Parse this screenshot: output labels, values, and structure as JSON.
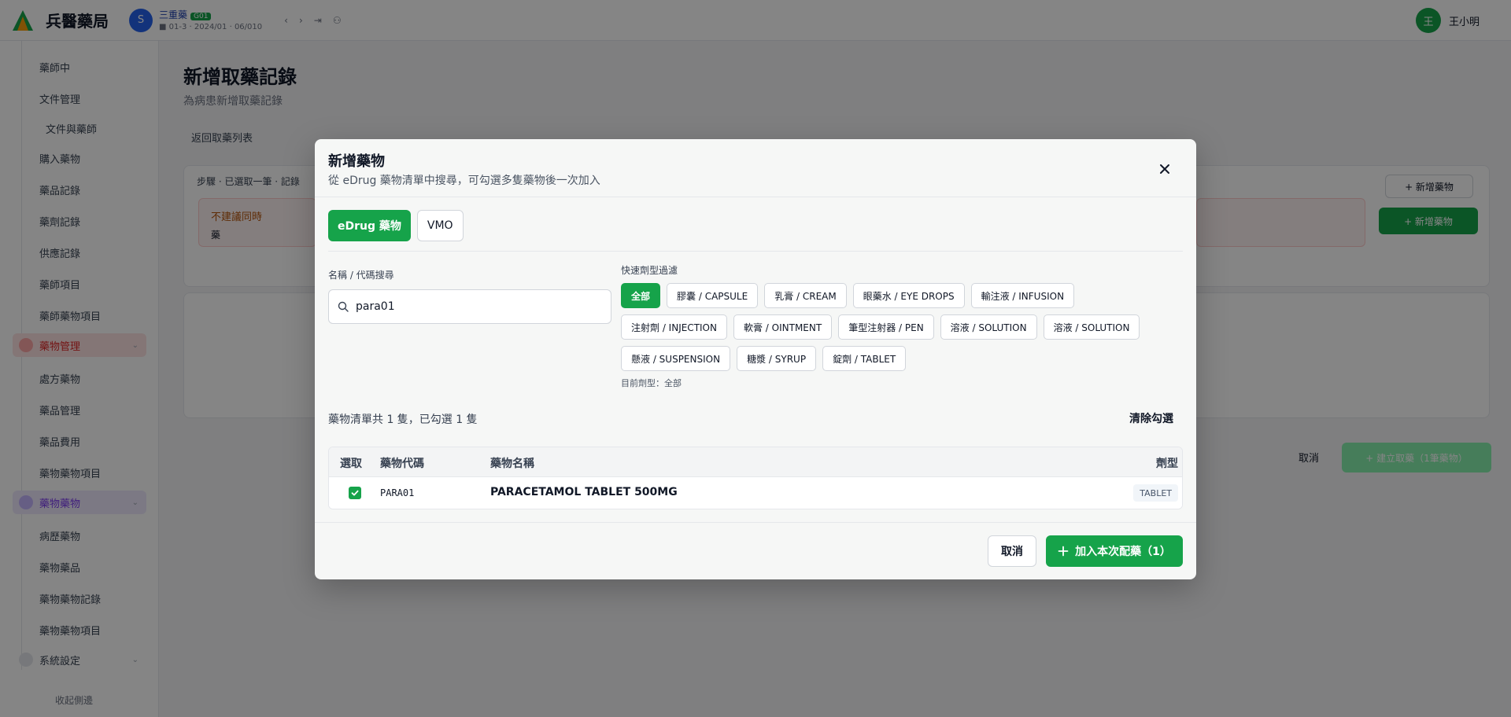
{
  "app": {
    "brand": "兵醫藥局",
    "pharmacy_badge": "S",
    "pharmacy_name": "三重藥",
    "pharmacy_tag": "G01",
    "pharmacy_sub": "■ 01-3 · 2024/01 · 06/010",
    "user_avatar": "王",
    "user_name": "王小明"
  },
  "sidebar": {
    "items": [
      "藥師中",
      "文件管理",
      "文件與藥師",
      "購入藥物",
      "藥品記錄",
      "藥劑記錄",
      "供應記錄",
      "藥師項目",
      "藥師藥物項目",
      "藥物管理",
      "處方藥物",
      "藥品管理",
      "藥品費用",
      "藥物藥物項目",
      "藥物藥物",
      "病歷藥物",
      "藥物藥品",
      "藥物藥物記錄",
      "藥物藥物項目",
      "系統設定"
    ],
    "footer": "收起側邊"
  },
  "page": {
    "title": "新增取藥記錄",
    "subtitle": "為病患新增取藥記錄",
    "back": "返回取藥列表",
    "step_text": "步驟 · 已選取一筆 · 記錄",
    "warn_title": "不建議同時",
    "warn_body": "藥",
    "outline_btn": "+ 新增藥物",
    "green_btn": "+ 新增藥物",
    "cancel": "取消",
    "submit": "+ 建立取藥（1筆藥物）"
  },
  "modal": {
    "title": "新增藥物",
    "subtitle": "從 eDrug 藥物清單中搜尋，可勾選多隻藥物後一次加入",
    "tabs": [
      {
        "label": "eDrug 藥物",
        "active": true
      },
      {
        "label": "VMO",
        "active": false
      }
    ],
    "search": {
      "label": "名稱 / 代碼搜尋",
      "value": "para01"
    },
    "filter": {
      "label": "快速劑型過濾",
      "chips": [
        {
          "label": "全部",
          "active": true
        },
        {
          "label": "膠囊 / CAPSULE",
          "active": false
        },
        {
          "label": "乳膏 / CREAM",
          "active": false
        },
        {
          "label": "眼藥水 / EYE DROPS",
          "active": false
        },
        {
          "label": "輸注液 / INFUSION",
          "active": false
        },
        {
          "label": "注射劑 / INJECTION",
          "active": false
        },
        {
          "label": "軟膏 / OINTMENT",
          "active": false
        },
        {
          "label": "筆型注射器 / PEN",
          "active": false
        },
        {
          "label": "溶液 / SOLUTION",
          "active": false
        },
        {
          "label": "溶液 / SOLUTION",
          "active": false
        },
        {
          "label": "懸液 / SUSPENSION",
          "active": false
        },
        {
          "label": "糖漿 / SYRUP",
          "active": false
        },
        {
          "label": "錠劑 / TABLET",
          "active": false
        }
      ],
      "current": "目前劑型：全部"
    },
    "summary": "藥物清單共 1 隻，已勾選 1 隻",
    "clear": "清除勾選",
    "table": {
      "headers": {
        "select": "選取",
        "code": "藥物代碼",
        "name": "藥物名稱",
        "form": "劑型"
      },
      "rows": [
        {
          "selected": true,
          "code": "PARA01",
          "name": "PARACETAMOL TABLET 500MG",
          "form": "TABLET"
        }
      ]
    },
    "cancel": "取消",
    "add": "加入本次配藥（1）"
  },
  "colors": {
    "accent": "#16a34a",
    "overlay": "rgba(0,0,0,0.48)"
  }
}
